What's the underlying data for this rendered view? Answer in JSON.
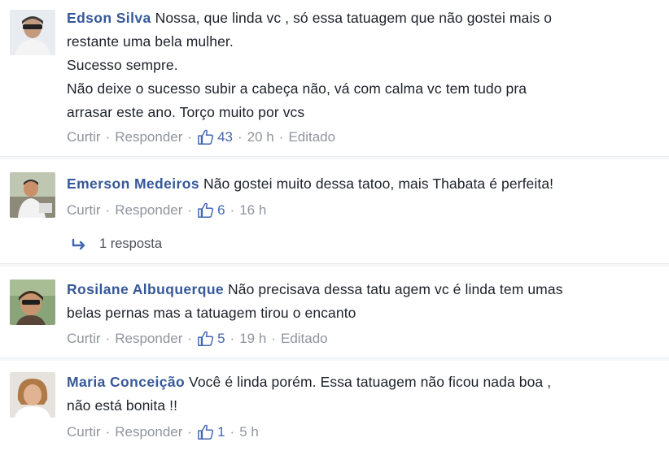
{
  "comments": [
    {
      "author": "Edson Silva",
      "lines": [
        "Nossa, que linda vc , só essa tatuagem que não gostei mais o",
        "restante uma bela mulher.",
        "Sucesso sempre.",
        "Não deixe o sucesso subir a cabeça não, vá com calma vc tem tudo pra",
        "arrasar este ano. Torço muito por vcs"
      ],
      "like_label": "Curtir",
      "reply_label": "Responder",
      "like_count": "43",
      "time": "20 h",
      "edited": "Editado"
    },
    {
      "author": "Emerson Medeiros",
      "lines": [
        "Não gostei muito dessa tatoo, mais Thabata é perfeita!"
      ],
      "like_label": "Curtir",
      "reply_label": "Responder",
      "like_count": "6",
      "time": "16 h",
      "replies_label": "1 resposta"
    },
    {
      "author": "Rosilane Albuquerque",
      "lines": [
        "Não precisava dessa tatu agem vc é linda tem umas",
        "belas pernas mas a tatuagem tirou o encanto"
      ],
      "like_label": "Curtir",
      "reply_label": "Responder",
      "like_count": "5",
      "time": "19 h",
      "edited": "Editado"
    },
    {
      "author": "Maria Conceição",
      "lines": [
        "Você é linda porém. Essa tatuagem não ficou nada boa ,",
        "não está bonita !!"
      ],
      "like_label": "Curtir",
      "reply_label": "Responder",
      "like_count": "1",
      "time": "5 h"
    }
  ],
  "colors": {
    "author": "#365899",
    "meta": "#90949c",
    "like": "#4267b2",
    "separator": "#e9ebee"
  }
}
